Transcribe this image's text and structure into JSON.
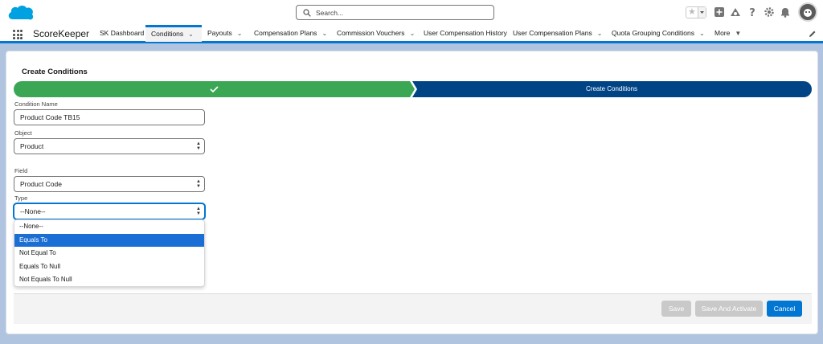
{
  "header": {
    "search_placeholder": "Search..."
  },
  "nav": {
    "app_name": "ScoreKeeper",
    "items": [
      {
        "label": "SK Dashboard"
      },
      {
        "label": "Conditions"
      },
      {
        "label": "Payouts"
      },
      {
        "label": "Compensation Plans"
      },
      {
        "label": "Commission Vouchers"
      },
      {
        "label": "User Compensation History"
      },
      {
        "label": "User Compensation Plans"
      },
      {
        "label": "Quota Grouping Conditions"
      },
      {
        "label": "More"
      }
    ]
  },
  "page": {
    "title": "Create Conditions",
    "path": {
      "step1_label": "",
      "step2_label": "Create Conditions",
      "complete_color": "#3ba755",
      "current_color": "#014486"
    }
  },
  "form": {
    "condition_name_label": "Condition Name",
    "condition_name_value": "Product Code TB15",
    "object_label": "Object",
    "object_value": "Product",
    "field_label": "Field",
    "field_value": "Product Code",
    "type_label": "Type",
    "type_value": "--None--",
    "type_options": [
      "--None--",
      "Equals To",
      "Not Equal To",
      "Equals To Null",
      "Not Equals To Null"
    ],
    "type_highlighted": "Equals To"
  },
  "footer": {
    "save_label": "Save",
    "save_activate_label": "Save And Activate",
    "cancel_label": "Cancel"
  }
}
